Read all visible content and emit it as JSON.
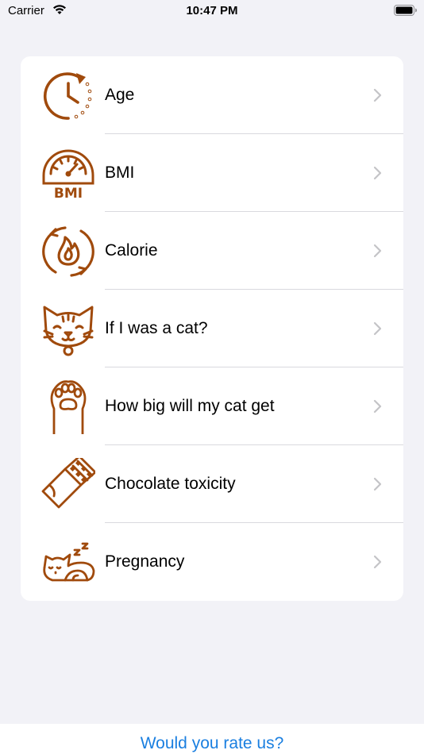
{
  "status_bar": {
    "carrier": "Carrier",
    "time": "10:47 PM",
    "icons": [
      "wifi-icon",
      "battery-icon"
    ]
  },
  "accent_color": "#a04a0c",
  "menu": {
    "items": [
      {
        "label": "Age",
        "icon": "clock-icon"
      },
      {
        "label": "BMI",
        "icon": "bmi-gauge-icon"
      },
      {
        "label": "Calorie",
        "icon": "calorie-flame-icon"
      },
      {
        "label": "If I was a cat?",
        "icon": "cat-face-icon"
      },
      {
        "label": "How big will my cat get",
        "icon": "cat-paw-icon"
      },
      {
        "label": "Chocolate toxicity",
        "icon": "chocolate-bar-icon"
      },
      {
        "label": "Pregnancy",
        "icon": "sleeping-cat-icon"
      }
    ]
  },
  "footer": {
    "rate_label": "Would you rate us?",
    "link_color": "#1a7fe0"
  }
}
